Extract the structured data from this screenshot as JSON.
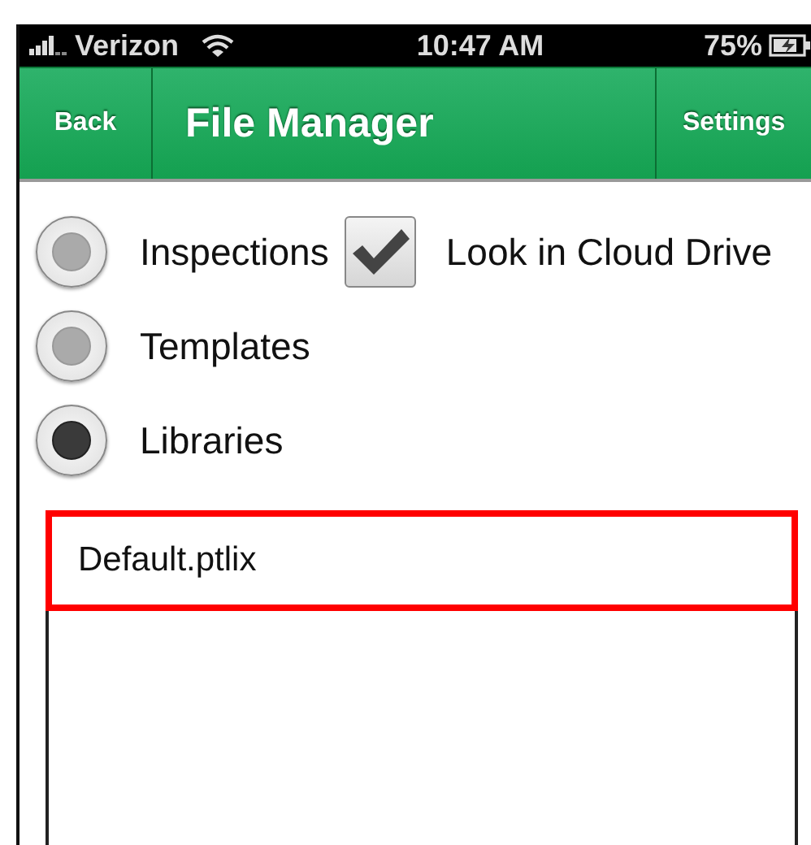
{
  "status_bar": {
    "carrier": "Verizon",
    "time": "10:47 AM",
    "battery": "75%"
  },
  "nav_bar": {
    "back": "Back",
    "title": "File Manager",
    "settings": "Settings"
  },
  "sources": [
    {
      "label": "Inspections",
      "selected": false
    },
    {
      "label": "Templates",
      "selected": false
    },
    {
      "label": "Libraries",
      "selected": true
    }
  ],
  "cloud_option": {
    "label": "Look in Cloud Drive",
    "checked": true
  },
  "files": [
    {
      "name": "Default.ptlix",
      "selected": true
    }
  ]
}
